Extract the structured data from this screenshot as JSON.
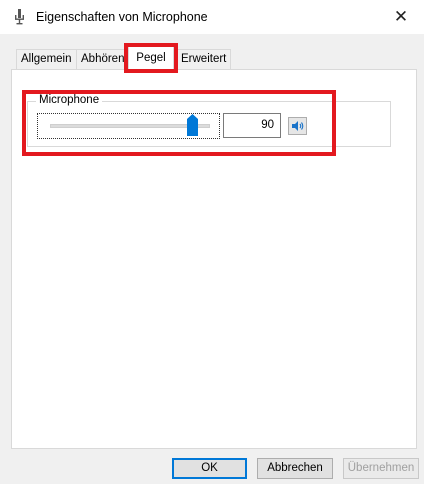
{
  "window": {
    "title": "Eigenschaften von Microphone",
    "close_glyph": "✕"
  },
  "tabs": [
    {
      "label": "Allgemein",
      "active": false
    },
    {
      "label": "Abhören",
      "active": false
    },
    {
      "label": "Pegel",
      "active": true
    },
    {
      "label": "Erweitert",
      "active": false
    }
  ],
  "levels": {
    "group_label": "Microphone",
    "value_text": "90",
    "slider_level_fraction": 0.9,
    "speaker_icon": "speaker-icon"
  },
  "buttons": {
    "ok": "OK",
    "cancel": "Abbrechen",
    "apply": "Übernehmen"
  },
  "colors": {
    "highlight": "#e3191f",
    "accent": "#0078d7"
  }
}
